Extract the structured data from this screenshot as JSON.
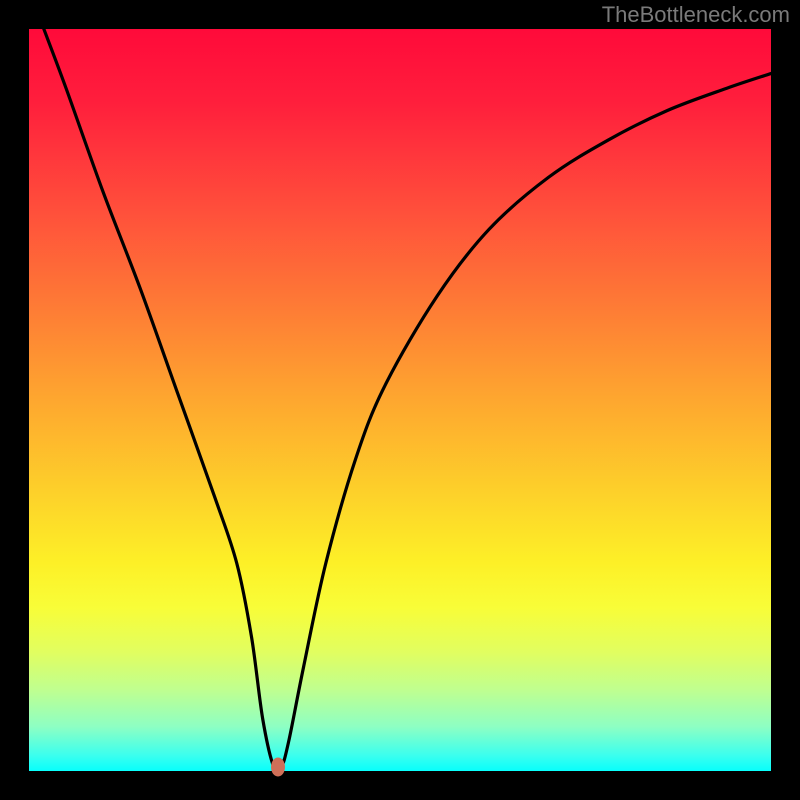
{
  "watermark": "TheBottleneck.com",
  "chart_data": {
    "type": "line",
    "title": "",
    "xlabel": "",
    "ylabel": "",
    "xlim": [
      0,
      100
    ],
    "ylim": [
      0,
      100
    ],
    "grid": false,
    "background_gradient": {
      "top": "#ff0a3a",
      "bottom": "#07fffc"
    },
    "series": [
      {
        "name": "bottleneck-curve",
        "color": "#000000",
        "x": [
          2,
          5,
          10,
          15,
          20,
          25,
          28,
          30,
          31.5,
          33,
          34,
          35,
          37,
          40,
          44,
          48,
          55,
          62,
          70,
          78,
          86,
          94,
          100
        ],
        "y": [
          100,
          92,
          78,
          65,
          51,
          37,
          28,
          18,
          7,
          0.5,
          0.5,
          4,
          14,
          28,
          42,
          52,
          64,
          73,
          80,
          85,
          89,
          92,
          94
        ]
      }
    ],
    "marker": {
      "x": 33.5,
      "y": 0.5,
      "color": "#cf6f58"
    }
  }
}
